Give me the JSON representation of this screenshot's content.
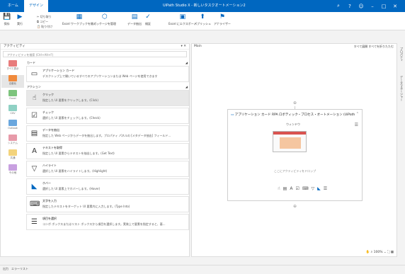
{
  "titlebar": {
    "tabs": [
      "ホーム",
      "デザイン"
    ],
    "window_title": "UiPath Studio X - 新しいタスクオートメーション2",
    "icons": [
      "search-icon",
      "help-icon",
      "account-icon",
      "minimize-icon",
      "maximize-icon",
      "close-icon"
    ]
  },
  "ribbon": {
    "save": "保存",
    "run": "実行",
    "cut": "切り取り",
    "copy": "コピー",
    "paste": "貼り付け",
    "excel_open": "Excel ワークブックを開く",
    "manage_packages": "パッケージを管理",
    "data_extract": "データ抽出",
    "check": "検証",
    "excel_export": "Excel にエクスポート",
    "publish": "パブリッシュ",
    "analyze": "アナライザー"
  },
  "panel": {
    "header": "アクティビティ",
    "search_placeholder": "アクティビティを検索 (Ctrl+Alt+F)",
    "categories": [
      {
        "label": "すべて表示",
        "color": "#e87c7c"
      },
      {
        "label": "自動化",
        "color": "#f08a3c"
      },
      {
        "label": "Excel",
        "color": "#7dc47d"
      },
      {
        "label": "CSV",
        "color": "#8fd1c4"
      },
      {
        "label": "Outlook",
        "color": "#6aa7de"
      },
      {
        "label": "システム",
        "color": "#e79aa9"
      },
      {
        "label": "共通",
        "color": "#f3d37c"
      },
      {
        "label": "その他",
        "color": "#c8a0e0"
      }
    ],
    "sections": {
      "card": "カード",
      "actions": "アクション"
    },
    "card_activity": {
      "title": "アプリケーション カード",
      "desc": "デスクトップ上で開いているすべてのアプリケーションまたは Web ページを使用できます"
    },
    "actions": [
      {
        "title": "クリック",
        "desc": "指定した UI 要素をクリックします。(Click)",
        "icon": "click-icon"
      },
      {
        "title": "チェック",
        "desc": "選択した UI 要素をチェックします。(Check)",
        "icon": "checkbox-icon"
      },
      {
        "title": "データを抽出",
        "desc": "指定した Web ページからデータを抽出します。プロパティ パネルの [メタデータ抽出] フィールド...",
        "icon": "table-icon"
      },
      {
        "title": "テキストを取得",
        "desc": "指定した UI 要素からテキストを抽出します。(Get Text)",
        "icon": "text-icon"
      },
      {
        "title": "ハイライト",
        "desc": "選択した UI 要素をハイライトします。(Highlight)",
        "icon": "highlight-icon"
      },
      {
        "title": "ホバー",
        "desc": "選択した UI 要素上でホバーします。(Hover)",
        "icon": "hover-icon"
      },
      {
        "title": "文字を入力",
        "desc": "指定したテキストをターゲット UI 要素内に入力します。(Type Into)",
        "icon": "keyboard-icon"
      },
      {
        "title": "項目を選択",
        "desc": "コンボ ボックスまたはリスト ボックスから項目を選択します。実装上で要素を指定すると、基...",
        "icon": "list-icon"
      }
    ]
  },
  "canvas": {
    "main_label": "Main",
    "expand_all": "すべて展開",
    "collapse_all": "すべてを折りたたむ",
    "card_title": "アプリケーション カード RPA ロボティック・プロセス・オートメーション (UiPath",
    "window_label": "ウィンドウ",
    "drop_hint": "ここにアクティビティをドロップ",
    "zoom": "100%"
  },
  "side": {
    "properties": "プロパティ",
    "data_manager": "データマネージャー"
  },
  "statusbar": {
    "text": "出力　エラーリスト"
  }
}
